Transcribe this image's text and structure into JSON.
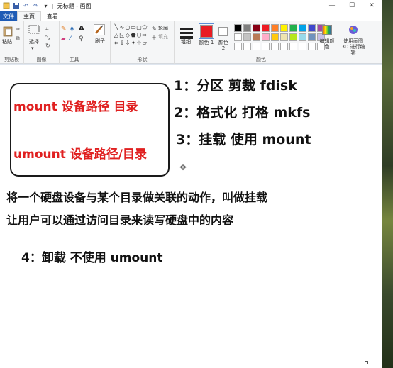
{
  "titlebar": {
    "title": "无标题 - 画图",
    "quick_access": [
      "save-icon",
      "undo-icon",
      "redo-icon"
    ],
    "controls": [
      "—",
      "☐",
      "✕"
    ]
  },
  "tabs": {
    "file": "文件",
    "items": [
      {
        "label": "主页",
        "active": true
      },
      {
        "label": "查看",
        "active": false
      }
    ]
  },
  "ribbon": {
    "clipboard": {
      "paste": "粘贴",
      "group": "剪贴板"
    },
    "image": {
      "select": "选择",
      "group": "图像"
    },
    "tools": {
      "group": "工具"
    },
    "brush": {
      "label": "刷子"
    },
    "shapes": {
      "outline": "轮廓",
      "fill": "填充",
      "group": "形状"
    },
    "size": {
      "label": "粗细"
    },
    "color1": {
      "label": "颜色 1",
      "value": "#e81c23"
    },
    "color2": {
      "label": "颜色 2",
      "value": "#ffffff"
    },
    "colors_group": "颜色",
    "edit_colors": "编辑颜色",
    "paint3d": "使用画图 3D 进行编辑",
    "palette": [
      "#000000",
      "#7f7f7f",
      "#880015",
      "#ed1c24",
      "#ff7f27",
      "#fff200",
      "#22b14c",
      "#00a2e8",
      "#3f48cc",
      "#a349a4",
      "#ffffff",
      "#c3c3c3",
      "#b97a57",
      "#ffaec9",
      "#ffc90e",
      "#efe4b0",
      "#b5e61d",
      "#99d9ea",
      "#7092be",
      "#c8bfe7",
      "#ffffff",
      "#ffffff",
      "#ffffff",
      "#ffffff",
      "#ffffff",
      "#ffffff",
      "#ffffff",
      "#ffffff",
      "#ffffff",
      "#ffffff"
    ]
  },
  "canvas": {
    "box_line1": "mount  设备路径  目录",
    "box_line2": "umount  设备路径/目录",
    "step1": "1：分区   剪裁    fdisk",
    "step2": "2：格式化  打格  mkfs",
    "step3": "3：挂载   使用  mount",
    "desc1": "将一个硬盘设备与某个目录做关联的动作，叫做挂载",
    "desc2": "让用户可以通过访问目录来读写硬盘中的内容",
    "step4": "4：卸载   不使用   umount"
  }
}
